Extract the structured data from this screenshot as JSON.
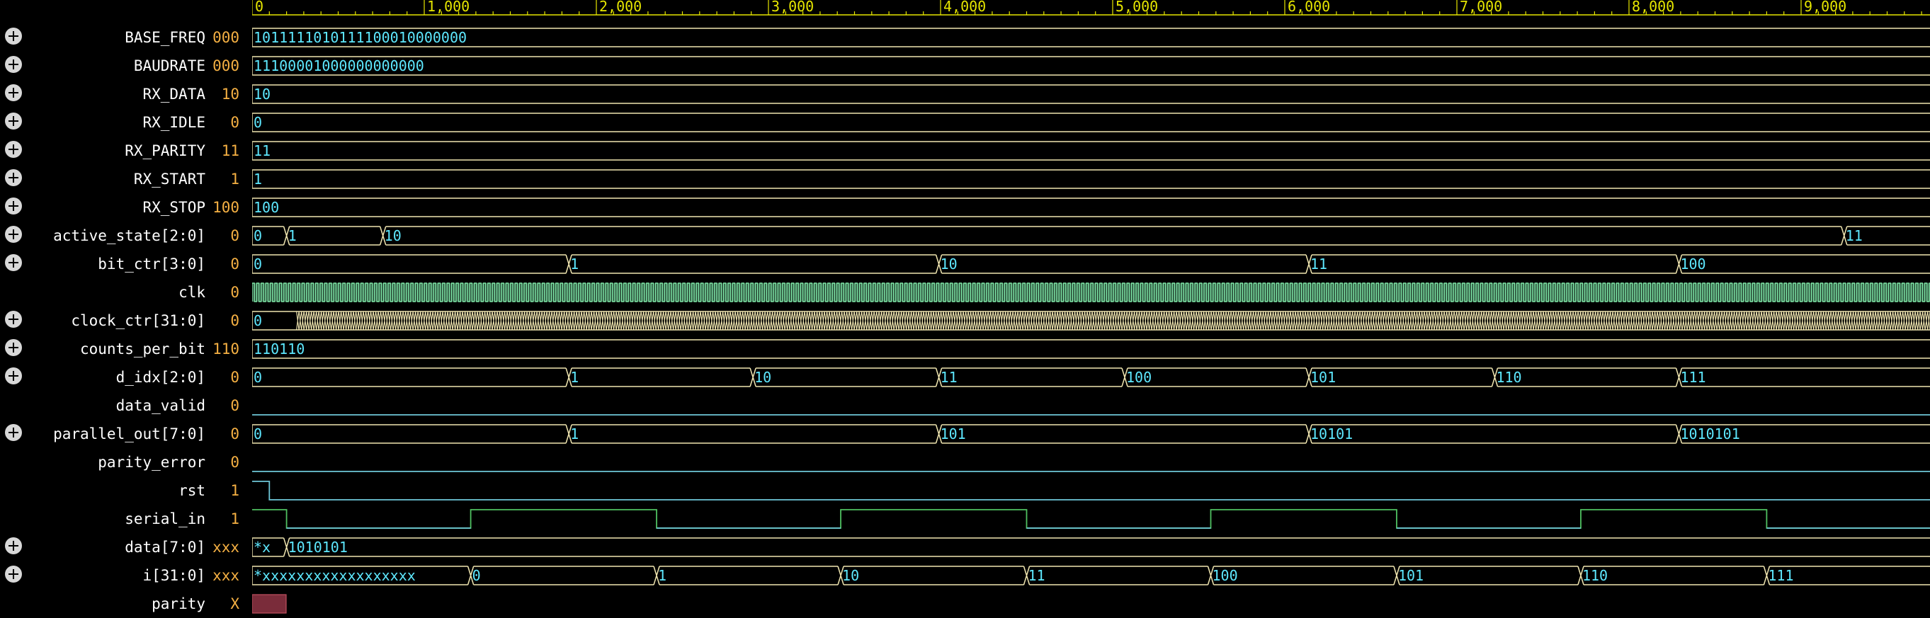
{
  "ruler": {
    "ticks": [
      "0",
      "1,000",
      "2,000",
      "3,000",
      "4,000",
      "5,000",
      "6,000",
      "7,000",
      "8,000",
      "9,000"
    ],
    "color": "#e6e600"
  },
  "colors": {
    "bus": "#f0e6b0",
    "bus_text": "#5ee8ff",
    "single_bit": "#6ec7d8",
    "clock": "#7fe8a8",
    "serial": "#4fc060",
    "name_text": "#ffffff",
    "value_text": "#f5b043",
    "unknown_fill": "#7a2c3a"
  },
  "signals": [
    {
      "name": "BASE_FREQ",
      "value": "000",
      "expandable": true,
      "kind": "bus",
      "transitions": [
        {
          "t": 0,
          "v": "1011111010111100010000000"
        }
      ]
    },
    {
      "name": "BAUDRATE",
      "value": "000",
      "expandable": true,
      "kind": "bus",
      "transitions": [
        {
          "t": 0,
          "v": "11100001000000000000"
        }
      ]
    },
    {
      "name": "RX_DATA",
      "value": "10",
      "expandable": true,
      "kind": "bus",
      "transitions": [
        {
          "t": 0,
          "v": "10"
        }
      ]
    },
    {
      "name": "RX_IDLE",
      "value": "0",
      "expandable": true,
      "kind": "bus",
      "transitions": [
        {
          "t": 0,
          "v": "0"
        }
      ]
    },
    {
      "name": "RX_PARITY",
      "value": "11",
      "expandable": true,
      "kind": "bus",
      "transitions": [
        {
          "t": 0,
          "v": "11"
        }
      ]
    },
    {
      "name": "RX_START",
      "value": "1",
      "expandable": true,
      "kind": "bus",
      "transitions": [
        {
          "t": 0,
          "v": "1"
        }
      ]
    },
    {
      "name": "RX_STOP",
      "value": "100",
      "expandable": true,
      "kind": "bus",
      "transitions": [
        {
          "t": 0,
          "v": "100"
        }
      ]
    },
    {
      "name": "active_state[2:0]",
      "value": "0",
      "expandable": true,
      "kind": "bus",
      "transitions": [
        {
          "t": 0,
          "v": "0"
        },
        {
          "t": 200,
          "v": "1"
        },
        {
          "t": 760,
          "v": "10"
        },
        {
          "t": 9250,
          "v": "11"
        }
      ]
    },
    {
      "name": "bit_ctr[3:0]",
      "value": "0",
      "expandable": true,
      "kind": "bus",
      "transitions": [
        {
          "t": 0,
          "v": "0"
        },
        {
          "t": 1840,
          "v": "1"
        },
        {
          "t": 3990,
          "v": "10"
        },
        {
          "t": 6140,
          "v": "11"
        },
        {
          "t": 8290,
          "v": "100"
        }
      ]
    },
    {
      "name": "clk",
      "value": "0",
      "expandable": false,
      "kind": "clock",
      "transitions": []
    },
    {
      "name": "clock_ctr[31:0]",
      "value": "0",
      "expandable": true,
      "kind": "counter",
      "transitions": [
        {
          "t": 0,
          "v": "0"
        }
      ]
    },
    {
      "name": "counts_per_bit",
      "value": "110",
      "expandable": true,
      "kind": "bus",
      "transitions": [
        {
          "t": 0,
          "v": "110110"
        }
      ]
    },
    {
      "name": "d_idx[2:0]",
      "value": "0",
      "expandable": true,
      "kind": "bus",
      "transitions": [
        {
          "t": 0,
          "v": "0"
        },
        {
          "t": 1840,
          "v": "1"
        },
        {
          "t": 2910,
          "v": "10"
        },
        {
          "t": 3990,
          "v": "11"
        },
        {
          "t": 5070,
          "v": "100"
        },
        {
          "t": 6140,
          "v": "101"
        },
        {
          "t": 7220,
          "v": "110"
        },
        {
          "t": 8290,
          "v": "111"
        }
      ]
    },
    {
      "name": "data_valid",
      "value": "0",
      "expandable": false,
      "kind": "bit",
      "transitions": [
        {
          "t": 0,
          "v": "0"
        }
      ]
    },
    {
      "name": "parallel_out[7:0]",
      "value": "0",
      "expandable": true,
      "kind": "bus",
      "transitions": [
        {
          "t": 0,
          "v": "0"
        },
        {
          "t": 1840,
          "v": "1"
        },
        {
          "t": 3990,
          "v": "101"
        },
        {
          "t": 6140,
          "v": "10101"
        },
        {
          "t": 8290,
          "v": "1010101"
        }
      ]
    },
    {
      "name": "parity_error",
      "value": "0",
      "expandable": false,
      "kind": "bit",
      "transitions": [
        {
          "t": 0,
          "v": "0"
        }
      ]
    },
    {
      "name": "rst",
      "value": "1",
      "expandable": false,
      "kind": "bit",
      "transitions": [
        {
          "t": 0,
          "v": "1"
        },
        {
          "t": 100,
          "v": "0"
        }
      ]
    },
    {
      "name": "serial_in",
      "value": "1",
      "expandable": false,
      "kind": "serial",
      "transitions": [
        {
          "t": 0,
          "v": "1"
        },
        {
          "t": 200,
          "v": "0"
        },
        {
          "t": 1270,
          "v": "1"
        },
        {
          "t": 2350,
          "v": "0"
        },
        {
          "t": 3420,
          "v": "1"
        },
        {
          "t": 4500,
          "v": "0"
        },
        {
          "t": 5570,
          "v": "1"
        },
        {
          "t": 6650,
          "v": "0"
        },
        {
          "t": 7720,
          "v": "1"
        },
        {
          "t": 8800,
          "v": "0"
        }
      ]
    },
    {
      "name": "data[7:0]",
      "value": "xxx",
      "expandable": true,
      "kind": "bus",
      "transitions": [
        {
          "t": 0,
          "v": "*x"
        },
        {
          "t": 200,
          "v": "1010101"
        }
      ]
    },
    {
      "name": "i[31:0]",
      "value": "xxx",
      "expandable": true,
      "kind": "bus",
      "transitions": [
        {
          "t": 0,
          "v": "*xxxxxxxxxxxxxxxxxx"
        },
        {
          "t": 1270,
          "v": "0"
        },
        {
          "t": 2350,
          "v": "1"
        },
        {
          "t": 3420,
          "v": "10"
        },
        {
          "t": 4500,
          "v": "11"
        },
        {
          "t": 5570,
          "v": "100"
        },
        {
          "t": 6650,
          "v": "101"
        },
        {
          "t": 7720,
          "v": "110"
        },
        {
          "t": 8800,
          "v": "111"
        }
      ]
    },
    {
      "name": "parity",
      "value": "X",
      "expandable": false,
      "kind": "unknown",
      "transitions": [
        {
          "t": 0,
          "v": "X"
        }
      ]
    }
  ]
}
